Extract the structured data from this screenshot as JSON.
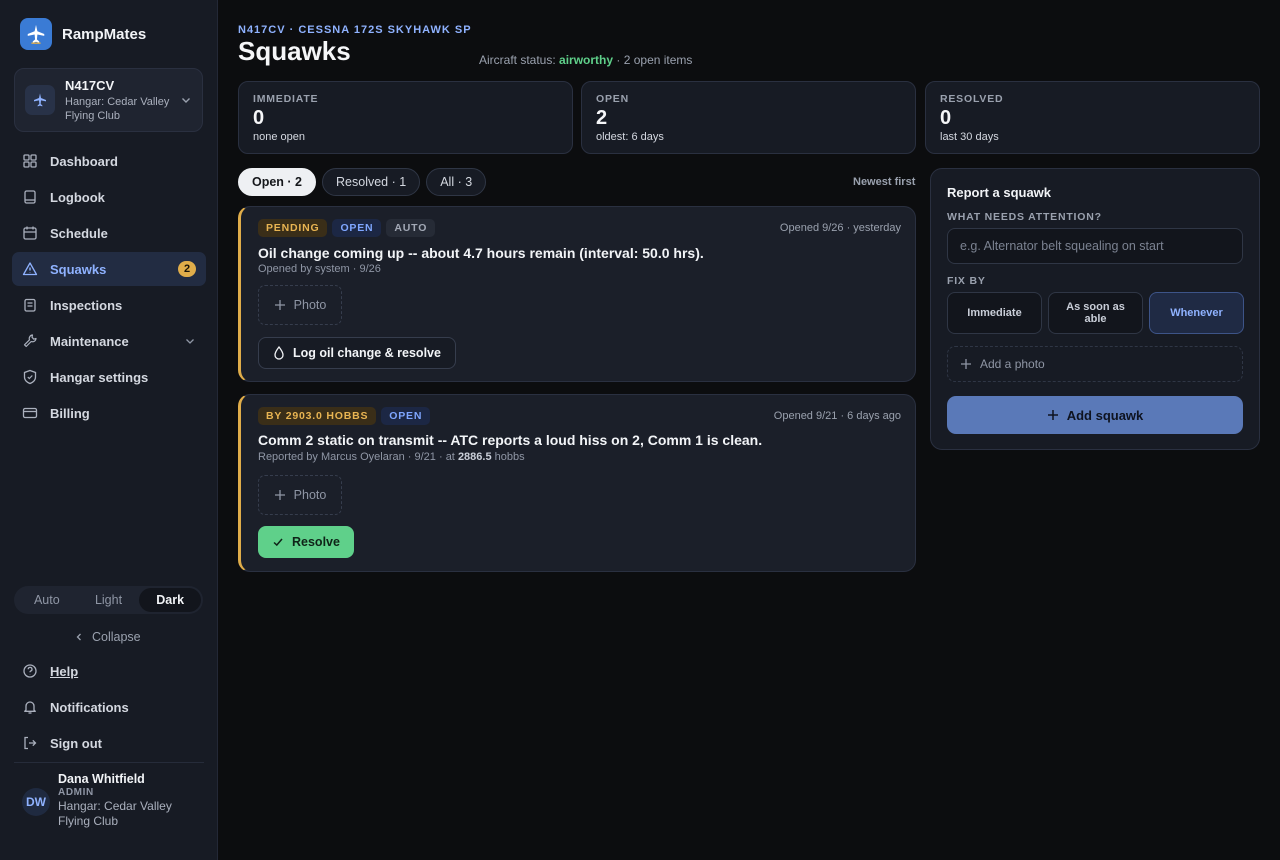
{
  "app": {
    "name": "RampMates"
  },
  "aircraft_selector": {
    "tail": "N417CV",
    "hangar": "Hangar: Cedar Valley Flying Club"
  },
  "nav": [
    {
      "label": "Dashboard",
      "icon": "dashboard-icon"
    },
    {
      "label": "Logbook",
      "icon": "logbook-icon"
    },
    {
      "label": "Schedule",
      "icon": "calendar-icon"
    },
    {
      "label": "Squawks",
      "icon": "warning-icon",
      "badge": "2",
      "active": true
    },
    {
      "label": "Inspections",
      "icon": "clipboard-icon"
    },
    {
      "label": "Maintenance",
      "icon": "wrench-icon"
    },
    {
      "label": "Hangar settings",
      "icon": "shield-icon"
    },
    {
      "label": "Billing",
      "icon": "credit-card-icon"
    }
  ],
  "theme": {
    "options": [
      "Auto",
      "Light",
      "Dark"
    ],
    "selected": "Dark"
  },
  "collapse_label": "Collapse",
  "footer_nav": {
    "help": "Help",
    "notifications": "Notifications",
    "sign_out": "Sign out"
  },
  "user": {
    "initials": "DW",
    "name": "Dana Whitfield",
    "role": "ADMIN",
    "hangar": "Hangar: Cedar Valley Flying Club"
  },
  "header": {
    "overline": "N417CV · CESSNA 172S SKYHAWK SP",
    "title": "Squawks",
    "status_prefix": "Aircraft status:",
    "status_value": "airworthy",
    "status_suffix": "· 2 open items"
  },
  "stats": [
    {
      "label": "IMMEDIATE",
      "value": "0",
      "sub": "none open"
    },
    {
      "label": "OPEN",
      "value": "2",
      "sub": "oldest: 6 days"
    },
    {
      "label": "RESOLVED",
      "value": "0",
      "sub": "last 30 days"
    }
  ],
  "filters": [
    {
      "label": "Open · 2",
      "selected": true
    },
    {
      "label": "Resolved · 1"
    },
    {
      "label": "All · 3"
    }
  ],
  "sort_label": "Newest first",
  "squawks": [
    {
      "tags": [
        "PENDING",
        "OPEN",
        "AUTO"
      ],
      "time": "Opened 9/26 · yesterday",
      "title": "Oil change coming up -- about 4.7 hours remain (interval: 50.0 hrs).",
      "meta": "Opened by system · 9/26",
      "photo_label": "Photo",
      "action_label": "Log oil change & resolve"
    },
    {
      "tags": [
        "BY 2903.0 HOBBS",
        "OPEN"
      ],
      "time": "Opened 9/21 · 6 days ago",
      "title": "Comm 2 static on transmit -- ATC reports a loud hiss on 2, Comm 1 is clean.",
      "meta_prefix": "Reported by Marcus Oyelaran · 9/21 · at",
      "meta_hobbs": "2886.5",
      "meta_suffix": "hobbs",
      "photo_label": "Photo",
      "action_label": "Resolve"
    }
  ],
  "report": {
    "title": "Report a squawk",
    "attention_label": "WHAT NEEDS ATTENTION?",
    "attention_placeholder": "e.g. Alternator belt squealing on start",
    "fix_label": "FIX BY",
    "fix_options": [
      "Immediate",
      "As soon as able",
      "Whenever"
    ],
    "fix_selected": "Whenever",
    "add_photo_label": "Add a photo",
    "submit_label": "Add squawk"
  },
  "colors": {
    "accent": "#8fb2ff",
    "warning": "#e0ad4a",
    "success": "#5fd08a",
    "submit": "#5a79b8"
  }
}
